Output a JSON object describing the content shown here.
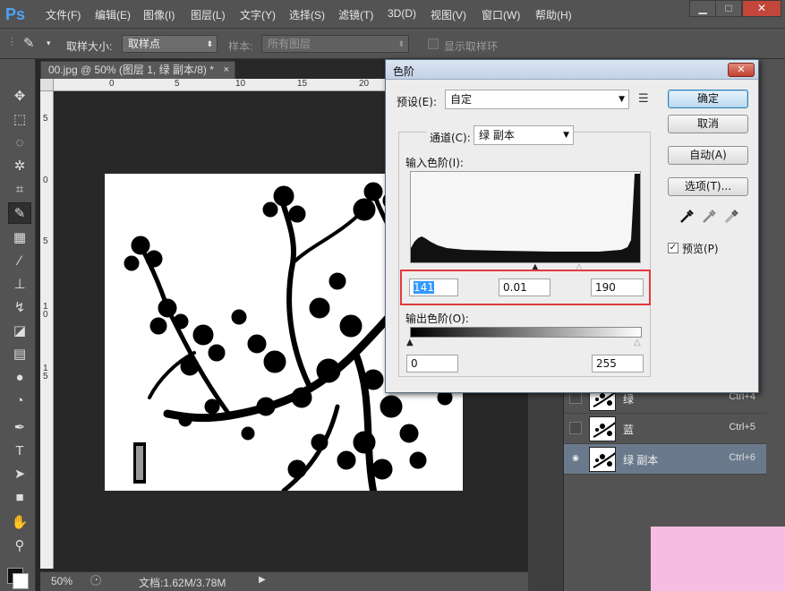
{
  "app": {
    "logo": "Ps",
    "menu": [
      "文件(F)",
      "编辑(E)",
      "图像(I)",
      "图层(L)",
      "文字(Y)",
      "选择(S)",
      "滤镜(T)",
      "3D(D)",
      "视图(V)",
      "窗口(W)",
      "帮助(H)"
    ],
    "window_buttons": {
      "minimize": "▁",
      "maximize": "□",
      "close": "✕"
    }
  },
  "options": {
    "sample_size_label": "取样大小:",
    "sample_size_value": "取样点",
    "sample_label": "样本:",
    "sample_value": "所有图层",
    "show_ring_label": "显示取样环"
  },
  "document": {
    "tab_title": "00.jpg @ 50% (图层 1, 绿 副本/8) *",
    "tab_close": "×",
    "ruler_top": [
      "0",
      "5",
      "10",
      "15",
      "20"
    ],
    "ruler_left": [
      "5",
      "0",
      "5",
      "1 0",
      "1 5"
    ],
    "zoom": "50%",
    "doc_info": "文档:1.62M/3.78M"
  },
  "channels": [
    {
      "name": "绿",
      "shortcut": "Ctrl+4",
      "visible": false,
      "selected": false
    },
    {
      "name": "蓝",
      "shortcut": "Ctrl+5",
      "visible": false,
      "selected": false
    },
    {
      "name": "绿 副本",
      "shortcut": "Ctrl+6",
      "visible": true,
      "selected": true
    }
  ],
  "levels_dialog": {
    "title": "色阶",
    "preset_label": "预设(E):",
    "preset_value": "自定",
    "channel_label": "通道(C):",
    "channel_value": "绿 副本",
    "input_levels_label": "输入色阶(I):",
    "input_black": "141",
    "input_gamma": "0.01",
    "input_white": "190",
    "output_levels_label": "输出色阶(O):",
    "output_black": "0",
    "output_white": "255",
    "buttons": {
      "ok": "确定",
      "cancel": "取消",
      "auto": "自动(A)",
      "options": "选项(T)..."
    },
    "preview_label": "预览(P)",
    "preview_checked": true
  },
  "colors": {
    "accent_blue": "#4fa3f5",
    "highlight_red": "#e0393c"
  }
}
